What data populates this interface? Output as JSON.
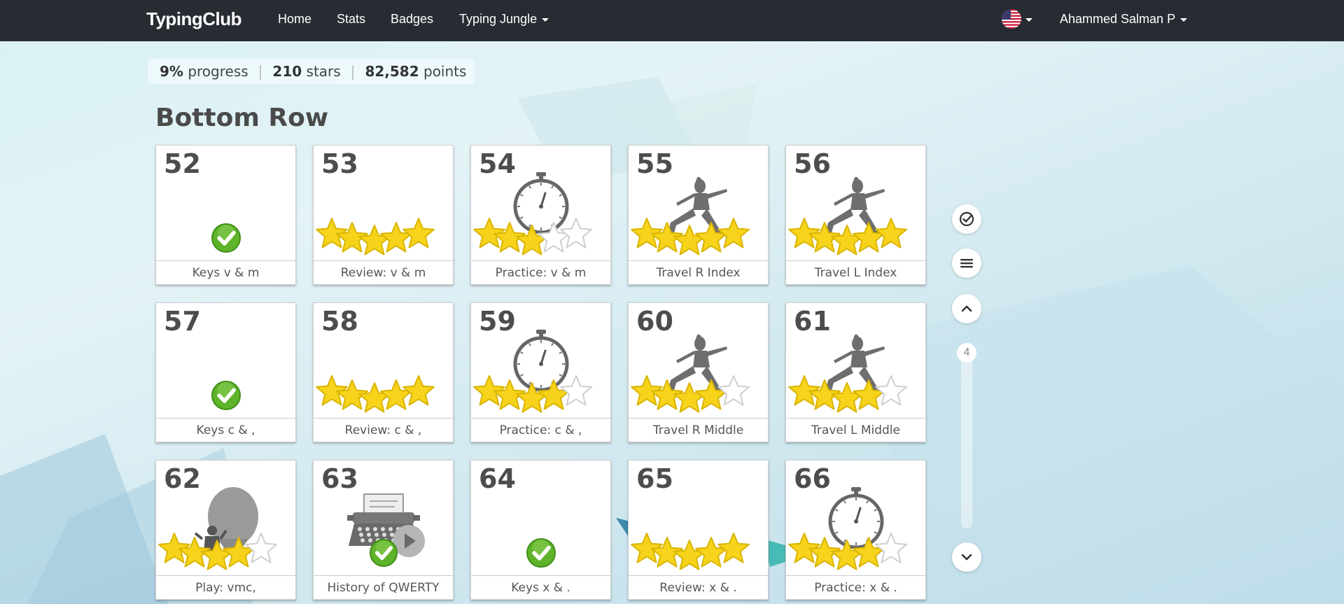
{
  "navbar": {
    "brand": "TypingClub",
    "links": [
      {
        "label": "Home"
      },
      {
        "label": "Stats"
      },
      {
        "label": "Badges"
      },
      {
        "label": "Typing Jungle"
      }
    ],
    "user_name": "Ahammed Salman P",
    "language_icon": "us-flag-icon"
  },
  "stats": {
    "progress_value": "9%",
    "progress_label": "progress",
    "stars_value": "210",
    "stars_label": "stars",
    "points_value": "82,582",
    "points_label": "points"
  },
  "section": {
    "title": "Bottom Row"
  },
  "lessons": [
    {
      "number": "52",
      "title": "Keys v & m",
      "type": "keys",
      "stars": 0,
      "completed": true
    },
    {
      "number": "53",
      "title": "Review: v & m",
      "type": "review",
      "stars": 5,
      "completed": true
    },
    {
      "number": "54",
      "title": "Practice: v & m",
      "type": "timer",
      "stars": 3,
      "completed": true
    },
    {
      "number": "55",
      "title": "Travel R Index",
      "type": "yoga",
      "stars": 5,
      "completed": true
    },
    {
      "number": "56",
      "title": "Travel L Index",
      "type": "yoga",
      "stars": 5,
      "completed": true
    },
    {
      "number": "57",
      "title": "Keys c & ,",
      "type": "keys",
      "stars": 0,
      "completed": true
    },
    {
      "number": "58",
      "title": "Review: c & ,",
      "type": "review",
      "stars": 5,
      "completed": true
    },
    {
      "number": "59",
      "title": "Practice: c & ,",
      "type": "timer",
      "stars": 4,
      "completed": true
    },
    {
      "number": "60",
      "title": "Travel R Middle",
      "type": "yoga",
      "stars": 4,
      "completed": true
    },
    {
      "number": "61",
      "title": "Travel L Middle",
      "type": "yoga",
      "stars": 4,
      "completed": true
    },
    {
      "number": "62",
      "title": "Play: vmc,",
      "type": "balloon",
      "stars": 4,
      "completed": true
    },
    {
      "number": "63",
      "title": "History of QWERTY",
      "type": "video",
      "stars": 0,
      "completed": true
    },
    {
      "number": "64",
      "title": "Keys x & .",
      "type": "keys",
      "stars": 0,
      "completed": true
    },
    {
      "number": "65",
      "title": "Review: x & .",
      "type": "review",
      "stars": 5,
      "completed": true
    },
    {
      "number": "66",
      "title": "Practice: x & .",
      "type": "timer",
      "stars": 4,
      "completed": true
    }
  ],
  "side_controls": {
    "page_indicator": "4",
    "buttons": [
      "check-circle-icon",
      "menu-icon",
      "chevron-up-icon",
      "chevron-down-icon"
    ]
  },
  "colors": {
    "navbar": "#272c33",
    "star_fill": "#f7d31c",
    "star_outline": "#d9b500",
    "check_green": "#5fb32a",
    "text_dark": "#4d4d4d"
  }
}
